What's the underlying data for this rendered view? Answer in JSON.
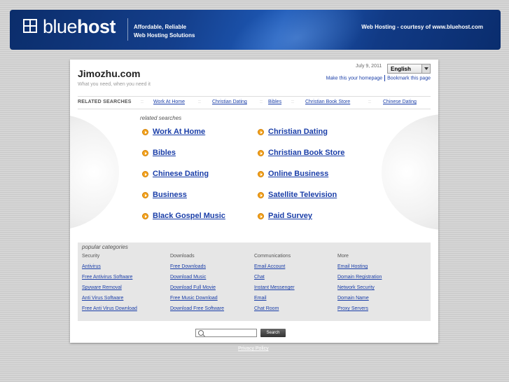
{
  "header": {
    "logo_part1": "blue",
    "logo_part2": "host",
    "tagline_line1": "Affordable, Reliable",
    "tagline_line2": "Web Hosting Solutions",
    "courtesy": "Web Hosting - courtesy of www.bluehost.com"
  },
  "site": {
    "title": "Jimozhu.com",
    "subtitle": "What you need, when you need it",
    "date": "July 9, 2011",
    "language": "English",
    "make_homepage": "Make this your homepage",
    "bookmark": "Bookmark this page"
  },
  "related_bar": {
    "label": "RELATED SEARCHES",
    "links": [
      "Work At Home",
      "Christian Dating",
      "Bibles",
      "Christian Book Store",
      "Chinese Dating"
    ]
  },
  "related": {
    "title": "related searches",
    "left": [
      "Work At Home",
      "Bibles",
      "Chinese Dating",
      "Business",
      "Black Gospel Music"
    ],
    "right": [
      "Christian Dating",
      "Christian Book Store",
      "Online Business",
      "Satellite Television",
      "Paid Survey"
    ]
  },
  "popular": {
    "title": "popular categories",
    "columns": [
      {
        "heading": "Security",
        "links": [
          "Antivirus",
          "Free Antivirus Software",
          "Spyware Removal",
          "Anti Virus Software",
          "Free Anti Virus Download"
        ]
      },
      {
        "heading": "Downloads",
        "links": [
          "Free Downloads",
          "Download Music",
          "Download Full Movie",
          "Free Music Download",
          "Download Free Software"
        ]
      },
      {
        "heading": "Communications",
        "links": [
          "Email Account",
          "Chat",
          "Instant Messenger",
          "Email",
          "Chat Room"
        ]
      },
      {
        "heading": "More",
        "links": [
          "Email Hosting",
          "Domain Registration",
          "Network Security",
          "Domain Name",
          "Proxy Servers"
        ]
      }
    ]
  },
  "search": {
    "button": "Search",
    "value": ""
  },
  "footer": {
    "privacy": "Privacy Policy"
  }
}
